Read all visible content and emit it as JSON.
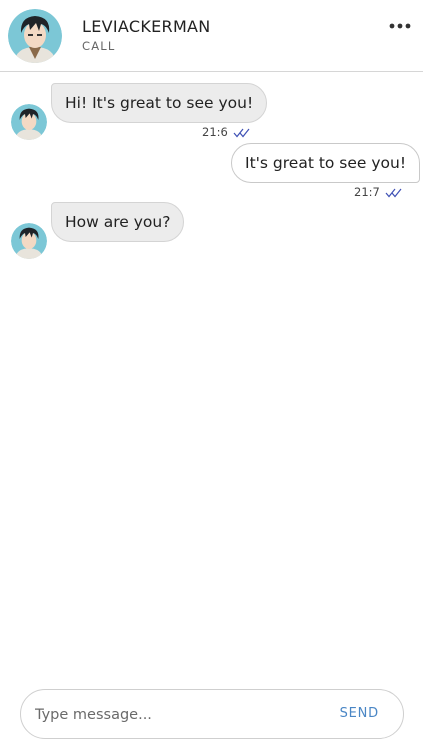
{
  "header": {
    "name": "LEVIACKERMAN",
    "subtitle": "CALL",
    "avatar_icon": "user-avatar",
    "menu_icon": "more-horizontal-icon"
  },
  "messages": [
    {
      "direction": "incoming",
      "text": "Hi! It's great to see you!",
      "time": "21:6",
      "status_icon": "double-check-icon"
    },
    {
      "direction": "outgoing",
      "text": "It's great to see you!",
      "time": "21:7",
      "status_icon": "double-check-icon"
    },
    {
      "direction": "incoming",
      "text": "How are you?"
    }
  ],
  "composer": {
    "placeholder": "Type message...",
    "value": "",
    "send_label": "SEND"
  },
  "colors": {
    "accent": "#4a86c5",
    "check": "#3f51b5",
    "incoming_bubble": "#ececec",
    "divider": "#d6d6d6"
  }
}
